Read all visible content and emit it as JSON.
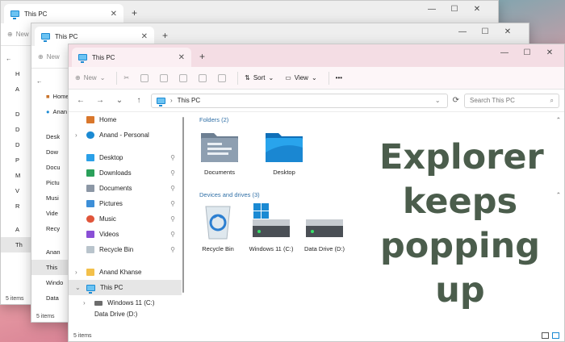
{
  "colors": {
    "accent": "#1b8ad3",
    "overlay_text": "#4b5d4c",
    "section_head": "#2f6fa6"
  },
  "back_window_1": {
    "tab_title": "This PC",
    "toolbar_new": "New",
    "sidebar": [
      "H",
      "A",
      "D",
      "D",
      "D",
      "P",
      "M",
      "V",
      "R",
      "A",
      "Th"
    ],
    "status": "5 items"
  },
  "back_window_2": {
    "tab_title": "This PC",
    "toolbar_new": "New",
    "sidebar": [
      "Home",
      "Anan",
      "Desk",
      "Dow",
      "Docu",
      "Pictu",
      "Musi",
      "Vide",
      "Recy",
      "Anan",
      "This",
      "Windo",
      "Data"
    ],
    "status": "5 items"
  },
  "front_window": {
    "tab_title": "This PC",
    "new_tab_glyph": "+",
    "close_glyph": "✕",
    "window_controls": [
      "—",
      "☐",
      "✕"
    ],
    "toolbar": {
      "new_label": "New",
      "sort_label": "Sort",
      "view_label": "View",
      "more_label": "•••"
    },
    "address": {
      "path": "This PC",
      "search_placeholder": "Search This PC"
    },
    "sidebar": {
      "top": [
        {
          "label": "Home",
          "icon": "home-icon"
        },
        {
          "label": "Anand - Personal",
          "icon": "cloud-icon"
        }
      ],
      "quick": [
        {
          "label": "Desktop",
          "icon": "desktop-icon"
        },
        {
          "label": "Downloads",
          "icon": "download-icon"
        },
        {
          "label": "Documents",
          "icon": "documents-icon"
        },
        {
          "label": "Pictures",
          "icon": "pictures-icon"
        },
        {
          "label": "Music",
          "icon": "music-icon"
        },
        {
          "label": "Videos",
          "icon": "videos-icon"
        },
        {
          "label": "Recycle Bin",
          "icon": "recycle-bin-icon"
        }
      ],
      "bottom": [
        {
          "label": "Anand Khanse",
          "icon": "folder-icon"
        },
        {
          "label": "This PC",
          "icon": "pc-icon"
        },
        {
          "label": "Windows 11 (C:)",
          "icon": "drive-icon"
        },
        {
          "label": "Data Drive (D:)",
          "icon": "drive-icon"
        }
      ]
    },
    "sections": {
      "folders": {
        "title": "Folders (2)",
        "items": [
          "Documents",
          "Desktop"
        ]
      },
      "drives": {
        "title": "Devices and drives (3)",
        "items": [
          "Recycle Bin",
          "Windows 11 (C:)",
          "Data Drive (D:)"
        ]
      }
    },
    "status": "5 items"
  },
  "overlay": {
    "lines": [
      "Explorer",
      "keeps",
      "popping",
      "up"
    ]
  }
}
